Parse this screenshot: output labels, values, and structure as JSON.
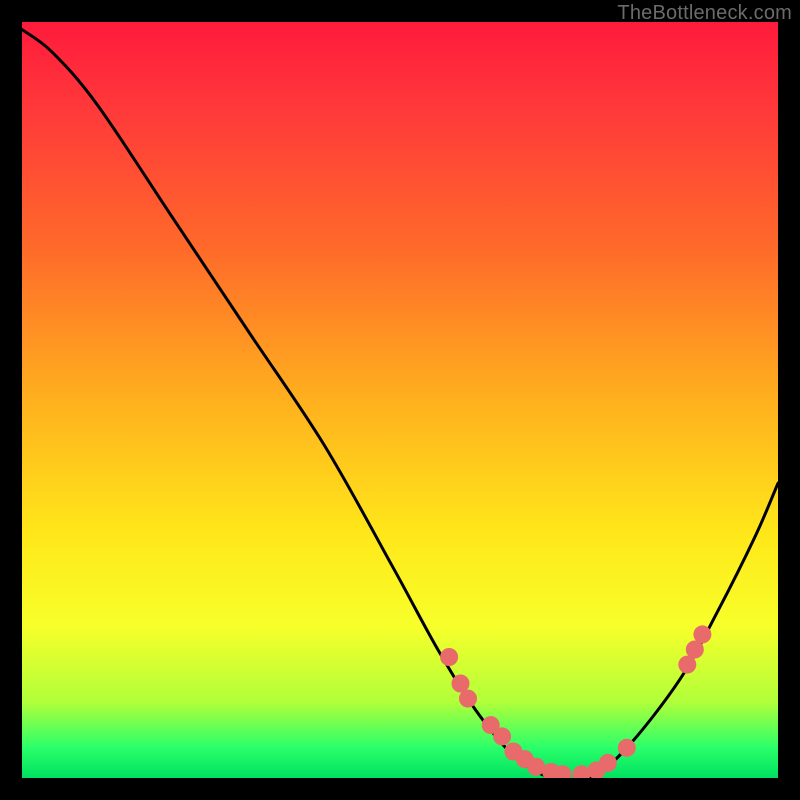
{
  "attribution": "TheBottleneck.com",
  "chart_data": {
    "type": "line",
    "title": "",
    "xlabel": "",
    "ylabel": "",
    "xlim": [
      0,
      100
    ],
    "ylim": [
      0,
      100
    ],
    "series": [
      {
        "name": "bottleneck-curve",
        "x": [
          0,
          4,
          10,
          20,
          30,
          40,
          49,
          55,
          60,
          65,
          70,
          75,
          80,
          87,
          92,
          97,
          100
        ],
        "values": [
          99,
          96,
          89,
          74,
          59,
          44,
          28,
          17,
          9,
          3,
          0,
          0,
          4,
          13,
          22,
          32,
          39
        ]
      }
    ],
    "markers": {
      "name": "highlight-dots",
      "color": "#e86a6a",
      "points": [
        {
          "x": 56.5,
          "y": 16
        },
        {
          "x": 58,
          "y": 12.5
        },
        {
          "x": 59,
          "y": 10.5
        },
        {
          "x": 62,
          "y": 7
        },
        {
          "x": 63.5,
          "y": 5.5
        },
        {
          "x": 65,
          "y": 3.5
        },
        {
          "x": 66.5,
          "y": 2.5
        },
        {
          "x": 68,
          "y": 1.5
        },
        {
          "x": 70,
          "y": 0.8
        },
        {
          "x": 71.5,
          "y": 0.5
        },
        {
          "x": 74,
          "y": 0.5
        },
        {
          "x": 76,
          "y": 1
        },
        {
          "x": 77.5,
          "y": 2
        },
        {
          "x": 80,
          "y": 4
        },
        {
          "x": 88,
          "y": 15
        },
        {
          "x": 89,
          "y": 17
        },
        {
          "x": 90,
          "y": 19
        }
      ]
    }
  }
}
